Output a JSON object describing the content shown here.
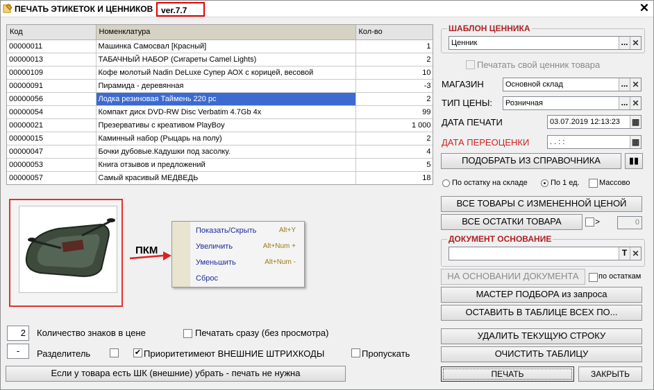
{
  "window": {
    "title": "ПЕЧАТЬ ЭТИКЕТОК И ЦЕННИКОВ",
    "version": "ver.7.7",
    "close_symbol": "✕"
  },
  "grid": {
    "columns": [
      "Код",
      "Номенклатура",
      "Кол-во"
    ],
    "rows": [
      {
        "code": "00000011",
        "name": "Машинка Самосвал [Красный]",
        "qty": "1"
      },
      {
        "code": "00000013",
        "name": "ТАБАЧНЫЙ НАБОР (Сигареты Camel Lights)",
        "qty": "2"
      },
      {
        "code": "00000109",
        "name": "Кофе молотый Nadin DeLuxe Супер АОХ с корицей, весовой",
        "qty": "10"
      },
      {
        "code": "00000091",
        "name": "Пирамида - деревянная",
        "qty": "-3"
      },
      {
        "code": "00000056",
        "name": "Лодка резиновая Таймень 220 рс",
        "qty": "2"
      },
      {
        "code": "00000054",
        "name": "Компакт диск DVD-RW Disc Verbatim 4.7Gb 4x",
        "qty": "99"
      },
      {
        "code": "00000021",
        "name": "Презервативы с креативом PlayBoy",
        "qty": "1 000"
      },
      {
        "code": "00000015",
        "name": "Каминный набор (Рыцарь на полу)",
        "qty": "2"
      },
      {
        "code": "00000047",
        "name": "Бочки дубовые.Кадушки под засолку.",
        "qty": "4"
      },
      {
        "code": "00000053",
        "name": "Книга отзывов и предложений",
        "qty": "5"
      },
      {
        "code": "00000057",
        "name": "Самый красивый МЕДВЕДЬ",
        "qty": "18"
      }
    ],
    "selected_index": 4
  },
  "annotation": {
    "pkm": "ПКМ"
  },
  "context_menu": {
    "items": [
      {
        "label": "Показать/Скрыть",
        "shortcut": "Alt+Y"
      },
      {
        "label": "Увеличить",
        "shortcut": "Alt+Num +"
      },
      {
        "label": "Уменьшить",
        "shortcut": "Alt+Num -"
      },
      {
        "label": "Сброс",
        "shortcut": ""
      }
    ]
  },
  "bottom": {
    "digits_value": "2",
    "digits_label": "Количество знаков в цене",
    "print_now_label": "Печатать сразу (без просмотра)",
    "separator_value": "-",
    "separator_label": "Разделитель",
    "priority_label": "Приоритетимеют ВНЕШНИЕ ШТРИХКОДЫ",
    "priority_checked": "✔",
    "skip_label": "Пропускать",
    "remove_button": "Если у товара есть ШК (внешние) убрать - печать не нужна"
  },
  "right": {
    "template_group": "ШАБЛОН ЦЕННИКА",
    "template_value": "Ценник",
    "own_tag_label": "Печатать свой ценник товара",
    "store_label": "МАГАЗИН",
    "store_value": "Основной склад",
    "price_type_label": "ТИП ЦЕНЫ:",
    "price_type_value": "Розничная",
    "print_date_label": "ДАТА ПЕЧАТИ",
    "print_date_value": "03.07.2019 12:13:23",
    "reprice_date_label": "ДАТА ПЕРЕОЦЕНКИ",
    "reprice_date_value": " .  .      :  :",
    "pick_button": "ПОДОБРАТЬ ИЗ СПРАВОЧНИКА",
    "radio_stock": "По остатку на складе",
    "radio_one": "По 1 ед.",
    "mass_label": "Массово",
    "changed_price_button": "ВСЕ ТОВАРЫ С ИЗМЕНЕННОЙ ЦЕНОЙ",
    "all_stock_button": "ВСЕ ОСТАТКИ ТОВАРА",
    "gt_label": ">",
    "gt_value": "0",
    "doc_group": "ДОКУМЕНТ ОСНОВАНИЕ",
    "based_doc_button": "НА ОСНОВАНИИ ДОКУМЕНТА",
    "by_stock_label": "по остаткам",
    "wizard_button": "МАСТЕР ПОДБОРА из запроса",
    "keep_button": "ОСТАВИТЬ В ТАБЛИЦЕ ВСЕХ ПО...",
    "delete_row_button": "УДАЛИТЬ ТЕКУЩУЮ СТРОКУ",
    "clear_button": "ОЧИСТИТЬ ТАБЛИЦУ",
    "print_button": "ПЕЧАТЬ",
    "close_button": "ЗАКРЫТЬ",
    "dots": "...",
    "x": "✕",
    "t": "T"
  },
  "colors": {
    "selection": "#3d6ad0",
    "group_title": "#b02020",
    "red_label": "#d02020",
    "highlight_border": "#e03030"
  }
}
